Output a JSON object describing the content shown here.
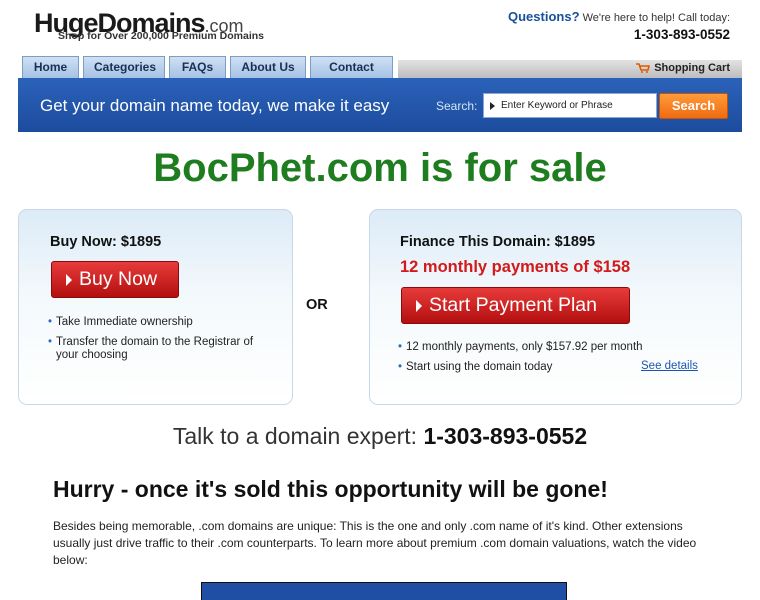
{
  "header": {
    "logo_bold": "HugeDomains",
    "logo_com": ".com",
    "tagline": "Shop for Over 200,000 Premium Domains",
    "questions_label": "Questions?",
    "questions_text": "We're here to help! Call today:",
    "phone": "1-303-893-0552"
  },
  "nav": {
    "tabs": [
      "Home",
      "Categories",
      "FAQs",
      "About Us",
      "Contact Us"
    ],
    "cart_label": "Shopping Cart",
    "cart_icon": "cart-icon"
  },
  "searchbar": {
    "slogan": "Get your domain name today, we make it easy",
    "label": "Search:",
    "placeholder": "Enter Keyword or Phrase",
    "button": "Search"
  },
  "headline": "BocPhet.com is for sale",
  "buy_box": {
    "title": "Buy Now: $1895",
    "button": "Buy Now",
    "bullets": [
      "Take Immediate ownership",
      "Transfer the domain to the Registrar of your choosing"
    ]
  },
  "or_text": "OR",
  "finance_box": {
    "title": "Finance This Domain: $1895",
    "subtitle": "12 monthly payments of $158",
    "button": "Start Payment Plan",
    "bullets": [
      "12 monthly payments, only $157.92 per month",
      "Start using the domain today"
    ],
    "details_link": "See details"
  },
  "talk": {
    "text": "Talk to a domain expert:",
    "phone": "1-303-893-0552"
  },
  "hurry": "Hurry - once it's sold this opportunity will be gone!",
  "paragraph": "Besides being memorable, .com domains are unique: This is the one and only .com name of it's kind. Other extensions usually just drive traffic to their .com counterparts. To learn more about premium .com domain valuations, watch the video below:",
  "colors": {
    "headline_green": "#1e7d1e",
    "accent_blue": "#1c4c9e",
    "sale_red": "#d21a1a",
    "search_orange": "#f06a10"
  }
}
